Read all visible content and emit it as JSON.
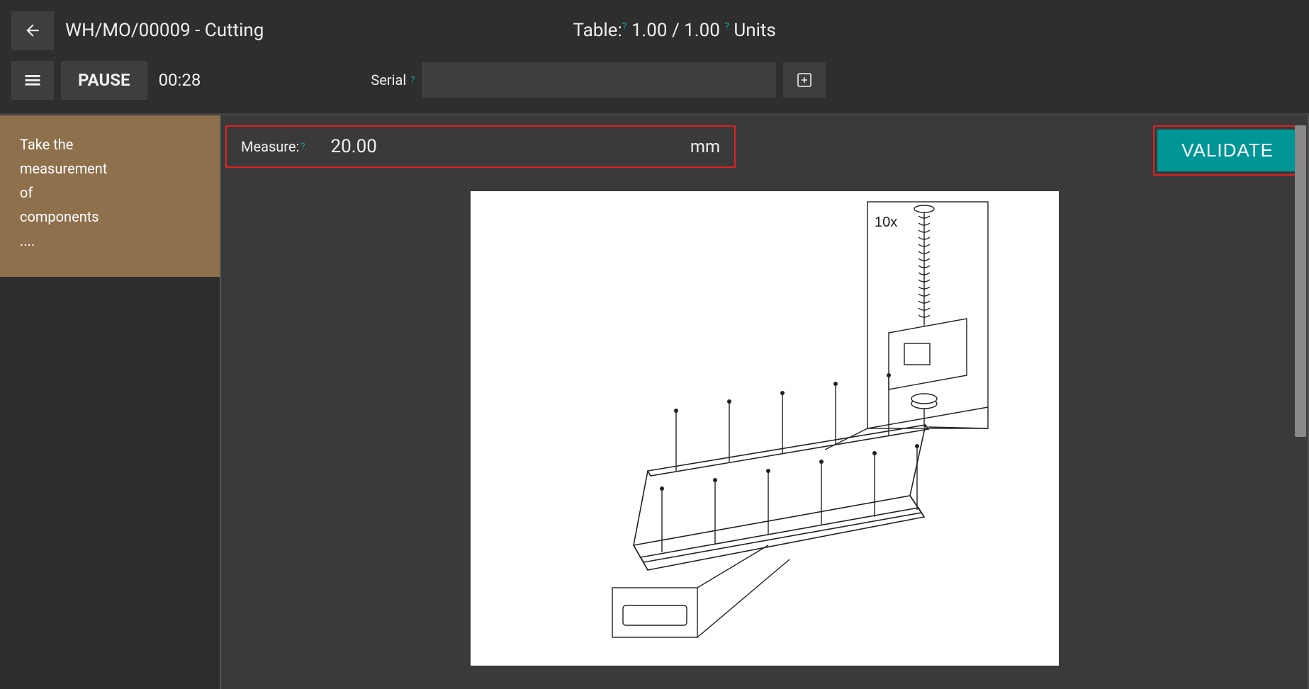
{
  "header": {
    "title": "WH/MO/00009 - Cutting",
    "table_label": "Table",
    "table_qty": "1.00",
    "table_sep": " / ",
    "table_total": "1.00",
    "units_label": "Units"
  },
  "toolbar": {
    "pause_label": "PAUSE",
    "timer": "00:28",
    "serial_label": "Serial"
  },
  "sidebar": {
    "step_text_l1": "Take the",
    "step_text_l2": "measurement",
    "step_text_l3": "of",
    "step_text_l4": "components",
    "step_text_l5": "...."
  },
  "main": {
    "measure_label": "Measure:",
    "measure_value": "20.00",
    "measure_unit": "mm",
    "validate_label": "VALIDATE",
    "diagram_annotation": "10x"
  }
}
